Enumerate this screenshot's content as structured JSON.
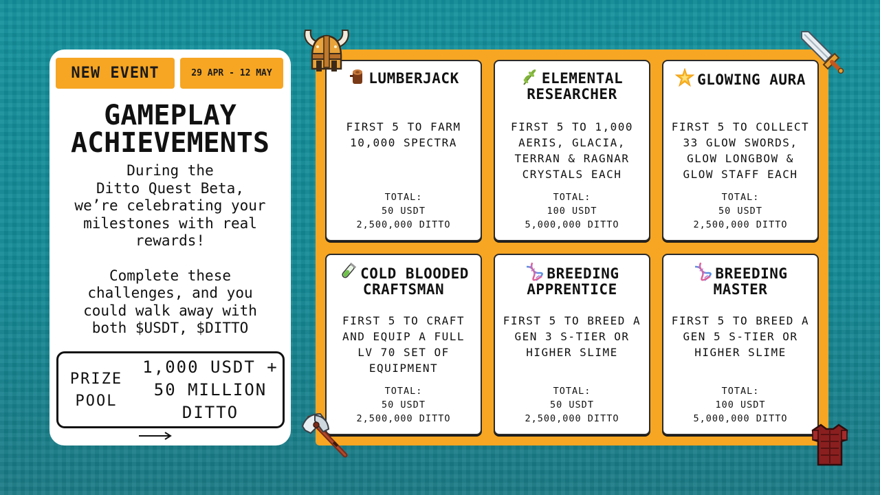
{
  "event": {
    "badge": "NEW EVENT",
    "date": "29 APR - 12 MAY",
    "title_line1": "GAMEPLAY",
    "title_line2": "ACHIEVEMENTS",
    "description": [
      "During the",
      "Ditto Quest Beta,",
      "we’re celebrating your",
      "milestones with real",
      "rewards!"
    ],
    "description2": [
      "Complete these",
      "challenges, and you",
      "could walk away with",
      "both $USDT, $DITTO"
    ],
    "prize_label": [
      "PRIZE",
      "POOL"
    ],
    "prize_value": [
      "1,000 USDT +",
      "50 MILLION",
      "DITTO"
    ]
  },
  "achievements": [
    {
      "icon": "log-icon",
      "title": [
        "LUMBERJACK"
      ],
      "description": [
        "FIRST 5 TO FARM",
        "10,000 SPECTRA"
      ],
      "total_label": "TOTAL:",
      "usdt": "50 USDT",
      "ditto": "2,500,000 DITTO"
    },
    {
      "icon": "herb-icon",
      "title": [
        "ELEMENTAL",
        "RESEARCHER"
      ],
      "description": [
        "FIRST 5 TO 1,000",
        "AERIS, GLACIA,",
        "TERRAN & RAGNAR",
        "CRYSTALS EACH"
      ],
      "total_label": "TOTAL:",
      "usdt": "100 USDT",
      "ditto": "5,000,000 DITTO"
    },
    {
      "icon": "glowing-star-icon",
      "title": [
        "GLOWING AURA"
      ],
      "description": [
        "FIRST 5 TO COLLECT",
        "33 GLOW SWORDS,",
        "GLOW LONGBOW &",
        "GLOW STAFF EACH"
      ],
      "total_label": "TOTAL:",
      "usdt": "50 USDT",
      "ditto": "2,500,000 DITTO"
    },
    {
      "icon": "potion-icon",
      "title": [
        "COLD BLOODED",
        "CRAFTSMAN"
      ],
      "description": [
        "FIRST 5 TO CRAFT",
        "AND EQUIP A FULL",
        "LV 70 SET OF",
        "EQUIPMENT"
      ],
      "total_label": "TOTAL:",
      "usdt": "50 USDT",
      "ditto": "2,500,000 DITTO"
    },
    {
      "icon": "dna-icon",
      "title": [
        "BREEDING",
        "APPRENTICE"
      ],
      "description": [
        "FIRST 5 TO BREED A",
        "GEN 3 S-TIER OR",
        "HIGHER SLIME"
      ],
      "total_label": "TOTAL:",
      "usdt": "50 USDT",
      "ditto": "2,500,000 DITTO"
    },
    {
      "icon": "dna-icon",
      "title": [
        "BREEDING",
        "MASTER"
      ],
      "description": [
        "FIRST 5 TO BREED A",
        "GEN 5 S-TIER OR",
        "HIGHER SLIME"
      ],
      "total_label": "TOTAL:",
      "usdt": "100 USDT",
      "ditto": "5,000,000 DITTO"
    }
  ],
  "colors": {
    "background": "#138a95",
    "panel": "#ffffff",
    "accent": "#f6a623",
    "text": "#111111"
  },
  "decorations": [
    "viking-helmet-icon",
    "pixel-sword-icon",
    "battle-axe-icon",
    "armor-icon"
  ]
}
